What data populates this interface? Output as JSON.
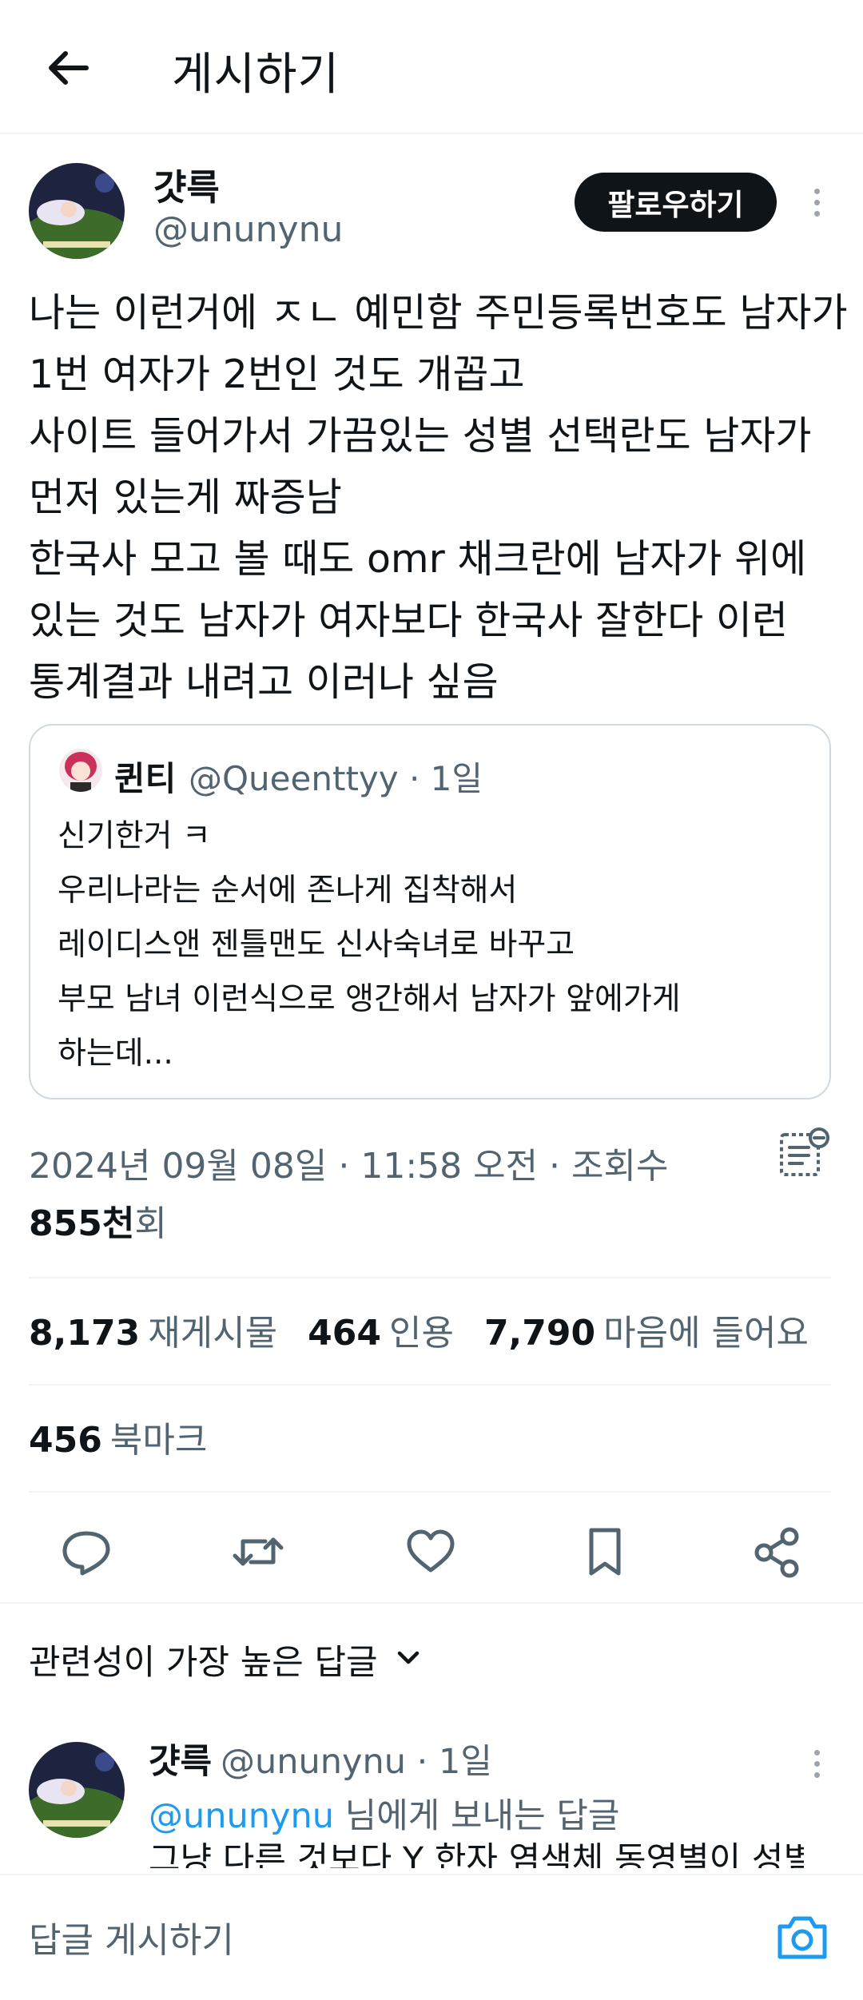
{
  "header": {
    "title": "게시하기"
  },
  "post": {
    "author_name": "걋륵",
    "author_handle": "@ununynu",
    "follow_label": "팔로우하기",
    "text_lines": [
      "나는 이런거에 ㅈㄴ 예민함 주민등록번호도 남자가",
      "1번 여자가 2번인 것도 개꼽고",
      "사이트 들어가서 가끔있는 성별 선택란도 남자가",
      "먼저 있는게 짜증남",
      "한국사 모고 볼 때도 omr 채크란에 남자가 위에",
      "있는 것도 남자가 여자보다 한국사 잘한다 이런",
      "통계결과 내려고 이러나 싶음"
    ],
    "quote": {
      "name": "퀸티",
      "handle_time": "@Queenttyy · 1일",
      "text_lines": [
        "신기한거 ㅋ",
        "우리나라는 순서에 존나게 집착해서",
        "레이디스앤 젠틀맨도 신사숙녀로 바꾸고",
        "부모 남녀 이런식으로 앵간해서 남자가 앞에가게",
        "하는데..."
      ]
    },
    "timestamp": "2024년 09월 08일 · 11:58 오전 · 조회수",
    "views_count": "855천",
    "views_suffix": "회",
    "stats": {
      "reposts_count": "8,173",
      "reposts_label": "재게시물",
      "quotes_count": "464",
      "quotes_label": "인용",
      "likes_count": "7,790",
      "likes_label": "마음에 들어요",
      "bookmarks_count": "456",
      "bookmarks_label": "북마크"
    }
  },
  "replies": {
    "sort_label": "관련성이 가장 높은 답글",
    "first": {
      "name": "걋륵",
      "handle_time": "@ununynu · 1일",
      "mention": "@ununynu",
      "reply_to_suffix": " 님에게 보내는 답글",
      "text_clipped": "그냥 다른 것보다 Y 한자 염색체 동영별이 성별"
    }
  },
  "composer": {
    "placeholder": "답글 게시하기"
  },
  "colors": {
    "accent": "#1d9bf0",
    "text": "#0f1419",
    "secondary": "#536471",
    "border": "#cfd9de"
  }
}
